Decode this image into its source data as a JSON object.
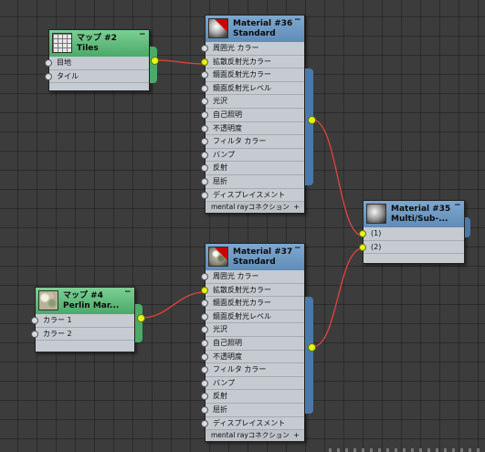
{
  "nodes": {
    "map2": {
      "title1": "マップ #2",
      "title2": "Tiles",
      "rows": [
        "目地",
        "タイル"
      ]
    },
    "mat36": {
      "title1": "Material #36",
      "title2": "Standard",
      "rows": [
        "周囲光 カラー",
        "拡散反射光カラー",
        "鏡面反射光カラー",
        "鏡面反射光レベル",
        "光沢",
        "自己照明",
        "不透明度",
        "フィルタ カラー",
        "バンプ",
        "反射",
        "屈折",
        "ディスプレイスメント"
      ],
      "footer": "mental rayコネクション",
      "footer_icon": "+"
    },
    "mat35": {
      "title1": "Material #35",
      "title2": "Multi/Sub-...",
      "rows": [
        "(1)",
        "(2)"
      ]
    },
    "mat37": {
      "title1": "Material #37",
      "title2": "Standard",
      "rows": [
        "周囲光 カラー",
        "拡散反射光カラー",
        "鏡面反射光カラー",
        "鏡面反射光レベル",
        "光沢",
        "自己照明",
        "不透明度",
        "フィルタ カラー",
        "バンプ",
        "反射",
        "屈折",
        "ディスプレイスメント"
      ],
      "footer": "mental rayコネクション",
      "footer_icon": "+"
    },
    "map4": {
      "title1": "マップ #4",
      "title2": "Perlin Mar...",
      "rows": [
        "カラー 1",
        "カラー 2"
      ]
    }
  },
  "minimize_glyph": "−",
  "colors": {
    "wire": "#e8423a",
    "active_pin": "#e4f51a",
    "material_header": "#6e9ac4",
    "map_header": "#5fbd7c"
  }
}
